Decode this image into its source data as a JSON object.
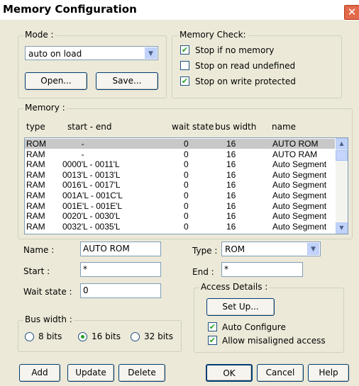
{
  "window": {
    "title": "Memory Configuration",
    "close_glyph": "✕"
  },
  "mode": {
    "legend": "Mode :",
    "selected": "auto on load",
    "open_label": "Open...",
    "save_label": "Save..."
  },
  "memory_check": {
    "legend": "Memory Check:",
    "options": [
      {
        "label": "Stop if no memory",
        "checked": true
      },
      {
        "label": "Stop on read undefined",
        "checked": false
      },
      {
        "label": "Stop on write protected",
        "checked": true
      }
    ]
  },
  "memory": {
    "legend": "Memory :",
    "headers": {
      "type": "type",
      "start_end": "start  -  end",
      "wait_state": "wait state",
      "bus_width": "bus width",
      "name": "name"
    },
    "rows": [
      {
        "type": "ROM",
        "range": "        -",
        "wait": "0",
        "bus": "16",
        "name": "AUTO ROM",
        "selected": true
      },
      {
        "type": "RAM",
        "range": "        -",
        "wait": "0",
        "bus": "16",
        "name": "AUTO RAM"
      },
      {
        "type": "RAM",
        "range": "0000'L - 0011'L",
        "wait": "0",
        "bus": "16",
        "name": "Auto Segment"
      },
      {
        "type": "RAM",
        "range": "0013'L - 0013'L",
        "wait": "0",
        "bus": "16",
        "name": "Auto Segment"
      },
      {
        "type": "RAM",
        "range": "0016'L - 0017'L",
        "wait": "0",
        "bus": "16",
        "name": "Auto Segment"
      },
      {
        "type": "RAM",
        "range": "001A'L - 001C'L",
        "wait": "0",
        "bus": "16",
        "name": "Auto Segment"
      },
      {
        "type": "RAM",
        "range": "001E'L - 001E'L",
        "wait": "0",
        "bus": "16",
        "name": "Auto Segment"
      },
      {
        "type": "RAM",
        "range": "0020'L - 0030'L",
        "wait": "0",
        "bus": "16",
        "name": "Auto Segment"
      },
      {
        "type": "RAM",
        "range": "0032'L - 0035'L",
        "wait": "0",
        "bus": "16",
        "name": "Auto Segment"
      }
    ]
  },
  "details": {
    "name_label": "Name :",
    "name_value": "AUTO ROM",
    "type_label": "Type :",
    "type_value": "ROM",
    "start_label": "Start :",
    "start_value": "*",
    "end_label": "End :",
    "end_value": "*",
    "wait_label": "Wait state :",
    "wait_value": "0"
  },
  "access": {
    "legend": "Access Details :",
    "setup_label": "Set Up...",
    "auto_configure": {
      "label": "Auto Configure",
      "checked": true
    },
    "misaligned": {
      "label": "Allow misaligned access",
      "checked": true
    }
  },
  "bus_width": {
    "legend": "Bus width :",
    "options": [
      {
        "label": "8 bits",
        "selected": false
      },
      {
        "label": "16 bits",
        "selected": true
      },
      {
        "label": "32 bits",
        "selected": false
      }
    ]
  },
  "buttons": {
    "add": "Add",
    "update": "Update",
    "delete": "Delete",
    "ok": "OK",
    "cancel": "Cancel",
    "help": "Help"
  }
}
